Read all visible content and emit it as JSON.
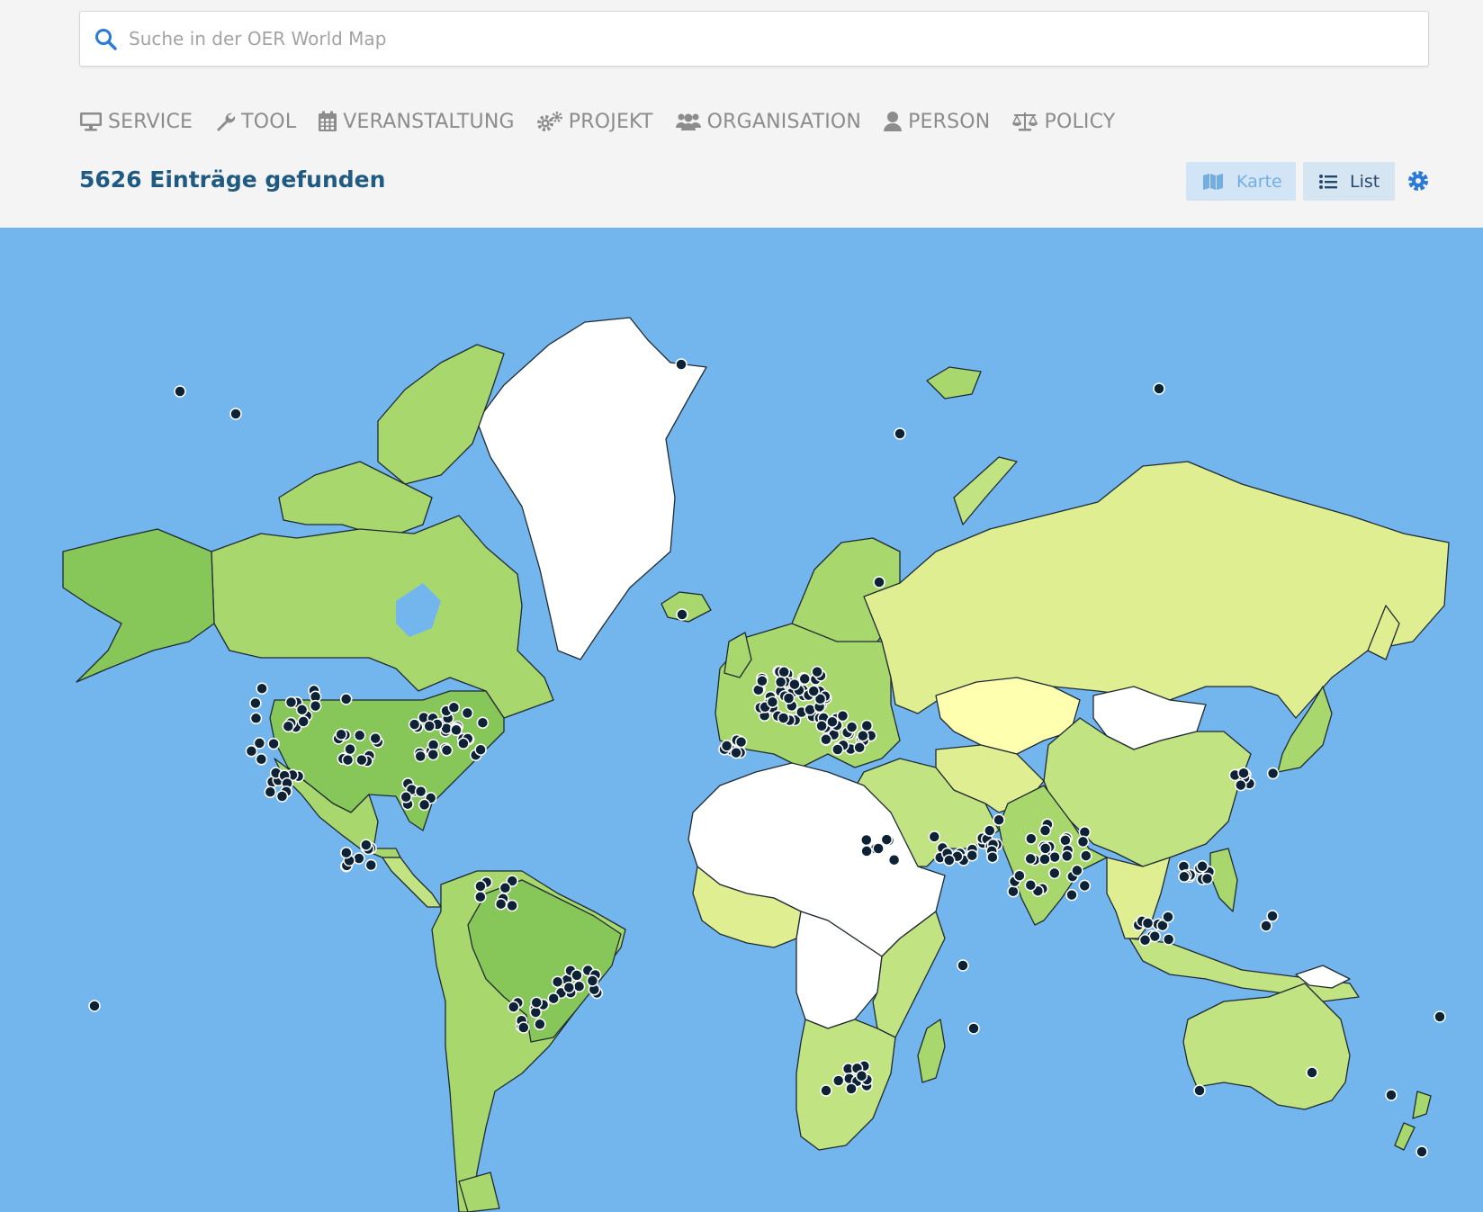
{
  "search": {
    "placeholder": "Suche in der OER World Map"
  },
  "filters": [
    {
      "label": "SERVICE",
      "icon": "monitor-icon"
    },
    {
      "label": "TOOL",
      "icon": "wrench-icon"
    },
    {
      "label": "VERANSTALTUNG",
      "icon": "calendar-icon"
    },
    {
      "label": "PROJEKT",
      "icon": "gears-icon"
    },
    {
      "label": "ORGANISATION",
      "icon": "users-icon"
    },
    {
      "label": "PERSON",
      "icon": "user-icon"
    },
    {
      "label": "POLICY",
      "icon": "balance-scale-icon"
    }
  ],
  "results": {
    "count_text": "5626 Einträge gefunden"
  },
  "view_toggle": {
    "map_label": "Karte",
    "list_label": "List",
    "active": "List"
  },
  "settings": {
    "icon": "gear-icon"
  },
  "map": {
    "legend": "none",
    "colors": {
      "ocean": "#73b6ee",
      "no_data": "#ffffff",
      "level_1": "#ffffb0",
      "level_2": "#e0ee92",
      "level_3": "#c2e381",
      "level_4": "#a8d86d",
      "level_5": "#87c759",
      "marker": "#0e2236",
      "marker_stroke": "#ffffff",
      "border": "#1f2a33"
    },
    "country_shading": {
      "USA": "level_5",
      "Brazil": "level_5",
      "Canada": "level_4",
      "Alaska": "level_5",
      "Mexico": "level_4",
      "Russia": "level_2",
      "China": "level_3",
      "Kazakhstan": "level_1",
      "Mongolia": "no_data",
      "Greenland": "no_data",
      "Australia": "level_3",
      "India": "level_4",
      "Europe": "level_4",
      "South Africa": "level_4",
      "West Africa": "no_data",
      "Central Africa": "no_data"
    }
  }
}
